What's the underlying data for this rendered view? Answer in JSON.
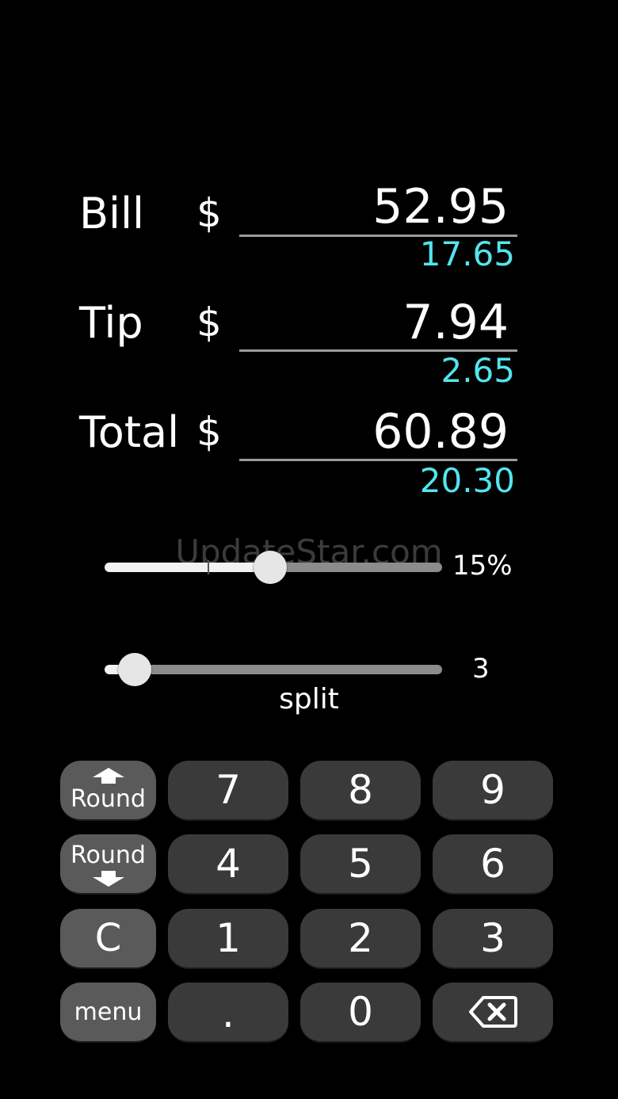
{
  "bill": {
    "label": "Bill",
    "currency": "$",
    "amount": "52.95",
    "per_person": "17.65"
  },
  "tip": {
    "label": "Tip",
    "currency": "$",
    "amount": "7.94",
    "per_person": "2.65"
  },
  "total": {
    "label": "Total",
    "currency": "$",
    "amount": "60.89",
    "per_person": "20.30"
  },
  "tip_slider": {
    "value_text": "15%",
    "fraction": 0.49
  },
  "split_slider": {
    "value_text": "3",
    "label": "split",
    "fraction": 0.09
  },
  "watermark": "UpdateStar.com",
  "keypad": {
    "round_up": "Round",
    "round_down": "Round",
    "clear": "C",
    "menu": "menu",
    "digits": [
      "7",
      "8",
      "9",
      "4",
      "5",
      "6",
      "1",
      "2",
      "3",
      ".",
      "0"
    ],
    "backspace_icon": "backspace-icon"
  },
  "colors": {
    "accent": "#52e5ee",
    "background": "#000000",
    "key": "#3a3a3a",
    "side_key": "#5a5a5a"
  }
}
